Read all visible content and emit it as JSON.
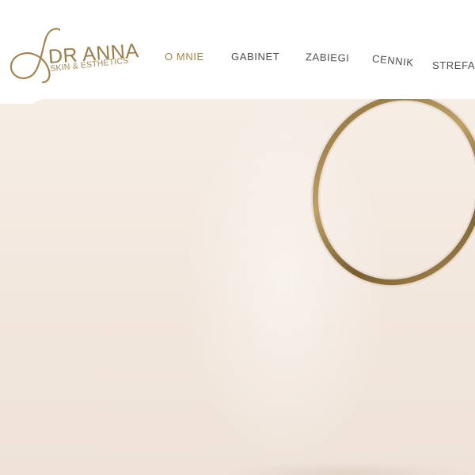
{
  "logo": {
    "name": "DR ANNA",
    "tagline": "SKIN & ESTHETICS"
  },
  "nav": {
    "items": [
      {
        "label": "O MNIE",
        "active": true
      },
      {
        "label": "GABINET",
        "active": false
      },
      {
        "label": "ZABIEGI",
        "active": false
      },
      {
        "label": "CENNIK",
        "active": false
      },
      {
        "label": "STREFA P",
        "active": false
      }
    ]
  },
  "colors": {
    "brand_gold": "#a2844c",
    "nav_text": "#4d4d4d",
    "hero_background": "#f3e9df"
  },
  "hero": {
    "image": "gold-hoop-earring"
  }
}
